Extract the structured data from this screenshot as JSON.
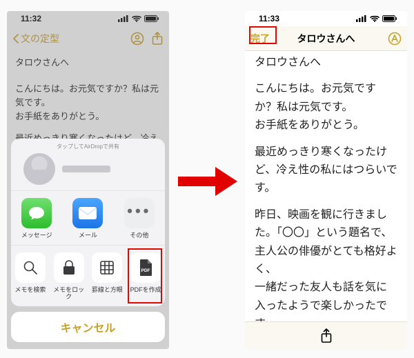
{
  "left": {
    "status": {
      "time": "11:32"
    },
    "nav": {
      "back_label": "文の定型"
    },
    "note_title": "タロウさんへ",
    "paragraphs": [
      "こんにちは。お元気ですか？私は元気です。\nお手紙をありがとう。",
      "最近めっきり寒くなったけど、冷え性の私にはつらいです。",
      "昨日、映画を観に行きました。「〇〇」という題名で、主人公の俳優がとても格好よ"
    ],
    "share": {
      "airdrop_hint": "タップしてAirDropで共有",
      "apps": [
        {
          "id": "messages",
          "label": "メッセージ"
        },
        {
          "id": "mail",
          "label": "メール"
        },
        {
          "id": "more",
          "label": "その他"
        }
      ],
      "actions": [
        {
          "id": "search",
          "label": "メモを検索"
        },
        {
          "id": "lock",
          "label": "メモをロック"
        },
        {
          "id": "grid",
          "label": "罫線と方眼"
        },
        {
          "id": "pdf",
          "label": "PDFを作成"
        }
      ],
      "cancel": "キャンセル"
    }
  },
  "right": {
    "status": {
      "time": "11:33"
    },
    "nav": {
      "done": "完了",
      "title": "タロウさんへ"
    },
    "note_title": "タロウさんへ",
    "paragraphs": [
      "こんにちは。お元気ですか？私は元気です。\nお手紙をありがとう。",
      "最近めっきり寒くなったけど、冷え性の私にはつらいです。",
      "昨日、映画を観に行きました。「〇〇」という題名で、主人公の俳優がとても格好よく、\n一緒だった友人も話を気に入ったようで楽しかったです。"
    ]
  }
}
